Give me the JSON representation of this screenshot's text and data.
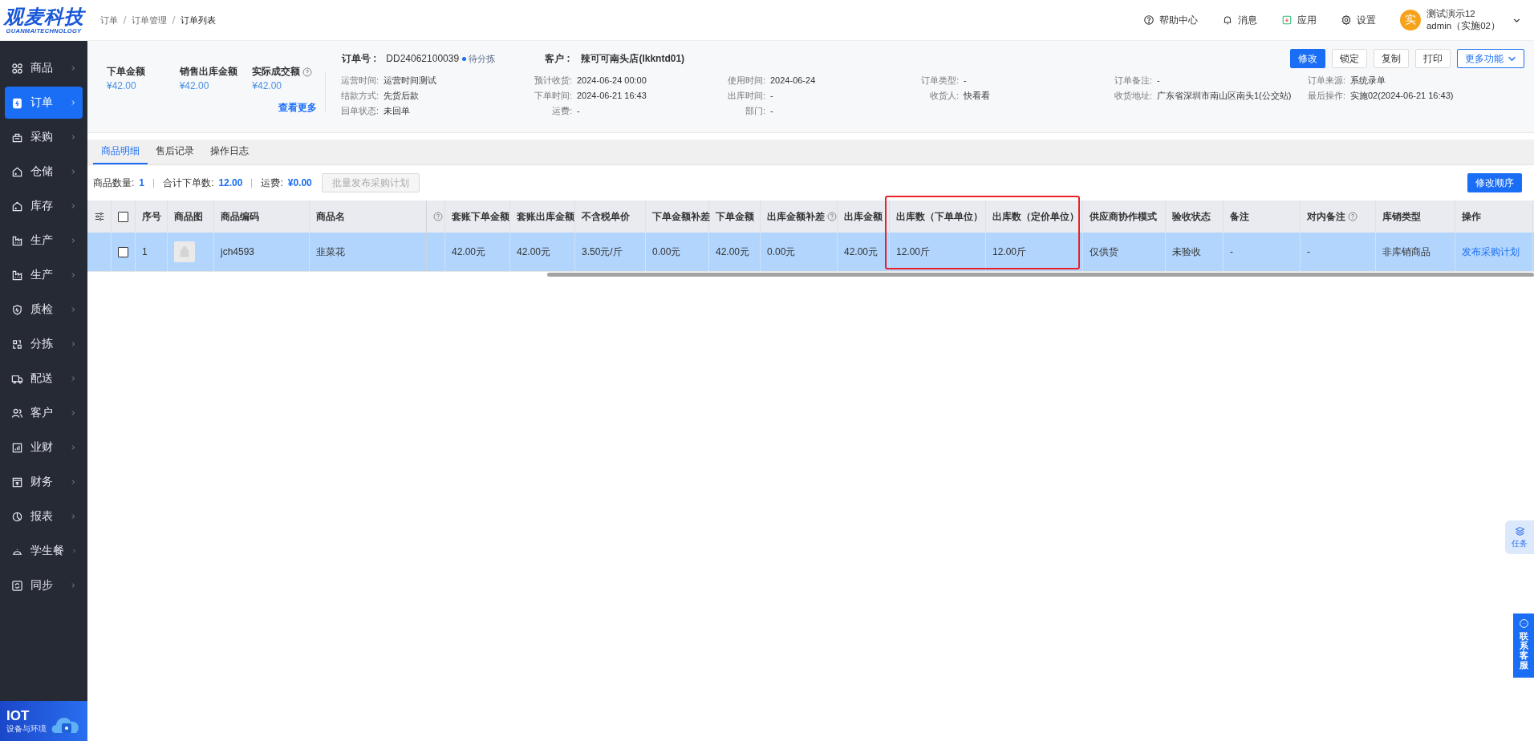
{
  "header": {
    "logo": {
      "title": "观麦科技",
      "subtitle": "GUANMAITECHNOLOGY"
    },
    "breadcrumb": [
      {
        "label": "订单",
        "current": false
      },
      {
        "label": "订单管理",
        "current": false
      },
      {
        "label": "订单列表",
        "current": true
      }
    ],
    "actions": [
      {
        "kind": "help",
        "label": "帮助中心"
      },
      {
        "kind": "bell",
        "label": "消息"
      },
      {
        "kind": "app",
        "label": "应用"
      },
      {
        "kind": "gear",
        "label": "设置"
      }
    ],
    "user": {
      "avatar": "实",
      "name": "测试演示12",
      "account": "admin（实施02）"
    }
  },
  "sidebar": {
    "items": [
      {
        "kind": "goods",
        "label": "商品",
        "selected": false
      },
      {
        "kind": "order",
        "label": "订单",
        "selected": true
      },
      {
        "kind": "purchase",
        "label": "采购",
        "selected": false
      },
      {
        "kind": "house",
        "label": "仓储",
        "selected": false
      },
      {
        "kind": "house",
        "label": "库存",
        "selected": false
      },
      {
        "kind": "factory",
        "label": "生产",
        "selected": false
      },
      {
        "kind": "factory",
        "label": "生产",
        "selected": false
      },
      {
        "kind": "shield",
        "label": "质检",
        "selected": false
      },
      {
        "kind": "sort",
        "label": "分拣",
        "selected": false
      },
      {
        "kind": "truck",
        "label": "配送",
        "selected": false
      },
      {
        "kind": "people",
        "label": "客户",
        "selected": false
      },
      {
        "kind": "bars",
        "label": "业财",
        "selected": false
      },
      {
        "kind": "cashbox",
        "label": "财务",
        "selected": false
      },
      {
        "kind": "pie",
        "label": "报表",
        "selected": false
      },
      {
        "kind": "cloche",
        "label": "学生餐",
        "selected": false
      },
      {
        "kind": "sync",
        "label": "同步",
        "selected": false
      }
    ],
    "banner": {
      "title": "IOT",
      "subtitle": "设备与环境"
    }
  },
  "summary": {
    "metrics": [
      {
        "label": "下单金额",
        "value": "¥42.00"
      },
      {
        "label": "销售出库金额",
        "value": "¥42.00"
      },
      {
        "label": "实际成交额",
        "value": "¥42.00",
        "help": true
      }
    ],
    "more_link": "查看更多"
  },
  "order": {
    "number_label": "订单号 :",
    "number": "DD24062100039",
    "status": "待分拣",
    "customer_label": "客户 :",
    "customer": "辣可可南头店(lkkntd01)",
    "field_rows": [
      [
        {
          "label": "运营时间:",
          "value": "运营时间测试"
        },
        {
          "label": "预计收货:",
          "value": "2024-06-24 00:00"
        },
        {
          "label": "使用时间:",
          "value": "2024-06-24"
        },
        {
          "label": "订单类型:",
          "value": "-"
        },
        {
          "label": "订单备注:",
          "value": "-"
        },
        {
          "label": "订单来源:",
          "value": "系统录单"
        }
      ],
      [
        {
          "label": "结款方式:",
          "value": "先货后款"
        },
        {
          "label": "下单时间:",
          "value": "2024-06-21 16:43"
        },
        {
          "label": "出库时间:",
          "value": "-"
        },
        {
          "label": "收货人:",
          "value": "快看看"
        },
        {
          "label": "收货地址:",
          "value": "广东省深圳市南山区南头1(公交站)"
        },
        {
          "label": "最后操作:",
          "value": "实施02(2024-06-21 16:43)"
        }
      ],
      [
        {
          "label": "回单状态:",
          "value": "未回单"
        },
        {
          "label": "运费:",
          "value": "-"
        },
        {
          "label": "部门:",
          "value": "-"
        }
      ]
    ],
    "buttons": [
      {
        "kind": "primary",
        "label": "修改"
      },
      {
        "kind": "plain",
        "label": "锁定"
      },
      {
        "kind": "plain",
        "label": "复制"
      },
      {
        "kind": "plain",
        "label": "打印"
      },
      {
        "kind": "dropdown",
        "label": "更多功能"
      }
    ]
  },
  "tabs": [
    {
      "label": "商品明细",
      "selected": true
    },
    {
      "label": "售后记录",
      "selected": false
    },
    {
      "label": "操作日志",
      "selected": false
    }
  ],
  "toolbar": {
    "stats": [
      {
        "label": "商品数量:",
        "value": "1"
      },
      {
        "label": "合计下单数:",
        "value": "12.00"
      },
      {
        "label": "运费:",
        "value": "¥0.00"
      }
    ],
    "batch_button": {
      "label": "批量发布采购计划",
      "disabled": true
    },
    "reorder_button": "修改顺序"
  },
  "table": {
    "columns": [
      {
        "kind": "settings"
      },
      {
        "kind": "checkbox",
        "checked": false
      },
      {
        "kind": "text",
        "label": "序号"
      },
      {
        "kind": "image",
        "label": "商品图"
      },
      {
        "kind": "text",
        "label": "商品编码"
      },
      {
        "kind": "text",
        "label": "商品名"
      },
      {
        "kind": "clipped",
        "help": true
      },
      {
        "kind": "text",
        "label": "套账下单金额"
      },
      {
        "kind": "text",
        "label": "套账出库金额"
      },
      {
        "kind": "text",
        "label": "不含税单价"
      },
      {
        "kind": "text",
        "label": "下单金额补差"
      },
      {
        "kind": "text",
        "label": "下单金额"
      },
      {
        "kind": "text",
        "label": "出库金额补差",
        "help": true
      },
      {
        "kind": "text",
        "label": "出库金额"
      },
      {
        "kind": "text",
        "label": "出库数（下单单位）",
        "highlighted": true
      },
      {
        "kind": "text",
        "label": "出库数（定价单位）",
        "highlighted": true
      },
      {
        "kind": "text",
        "label": "供应商协作模式"
      },
      {
        "kind": "text",
        "label": "验收状态"
      },
      {
        "kind": "text",
        "label": "备注"
      },
      {
        "kind": "text",
        "label": "对内备注",
        "help": true
      },
      {
        "kind": "text",
        "label": "库销类型"
      },
      {
        "kind": "link",
        "label": "操作"
      }
    ],
    "rows": [
      {
        "selected": true,
        "checked": false,
        "cells": [
          "",
          "",
          "1",
          "",
          "jch4593",
          "韭菜花",
          "",
          "42.00元",
          "42.00元",
          "3.50元/斤",
          "0.00元",
          "42.00元",
          "0.00元",
          "42.00元",
          "12.00斤",
          "12.00斤",
          "仅供货",
          "未验收",
          "-",
          "-",
          "非库销商品",
          "发布采购计划"
        ]
      }
    ]
  },
  "floating": {
    "task": "任务",
    "service": "联系客服"
  }
}
